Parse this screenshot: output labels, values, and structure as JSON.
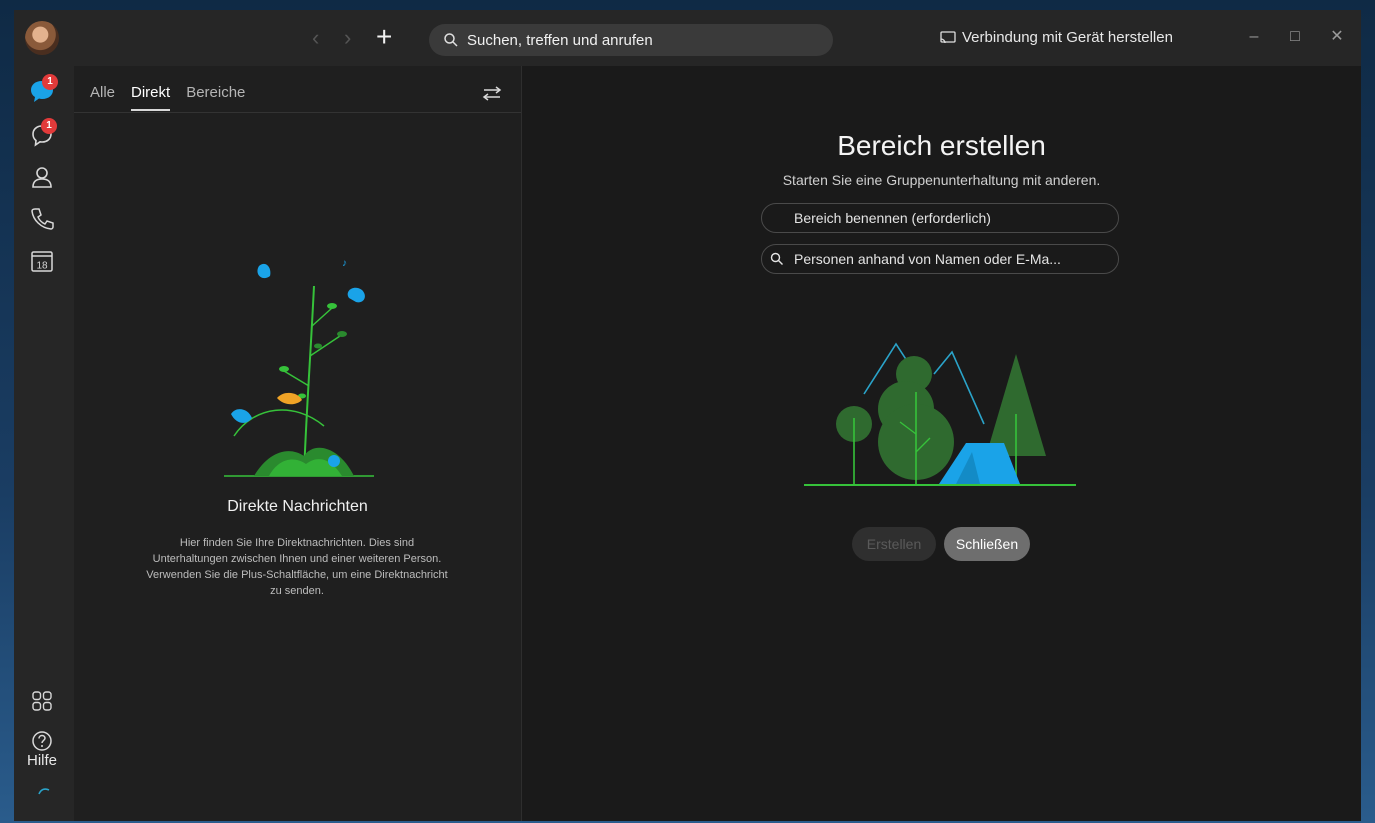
{
  "titlebar": {
    "search_placeholder": "Suchen, treffen und anrufen",
    "connect_label": "Verbindung mit Gerät herstellen",
    "plus_label": "+"
  },
  "leftnav": {
    "messages_badge": "1",
    "teams_badge": "1",
    "calendar_day": "18",
    "help_label": "Hilfe"
  },
  "listpanel": {
    "tabs": [
      "Alle",
      "Direkt",
      "Bereiche"
    ],
    "active_tab": "Direkt",
    "empty_title": "Direkte Nachrichten",
    "empty_description": "Hier finden Sie Ihre Direktnachrichten. Dies sind Unterhaltungen zwischen Ihnen und einer weiteren Person. Verwenden Sie die Plus-Schaltfläche, um eine Direktnachricht zu senden."
  },
  "main": {
    "title": "Bereich erstellen",
    "subtitle": "Starten Sie eine Gruppenunterhaltung mit anderen.",
    "name_placeholder": "Bereich benennen (erforderlich)",
    "people_placeholder": "Personen anhand von Namen oder E-Ma...",
    "create_label": "Erstellen",
    "close_label": "Schließen"
  },
  "colors": {
    "accent_blue": "#1aa3e8",
    "badge_red": "#e23a3a",
    "tree_green": "#2f6a2f",
    "line_green": "#36c23a"
  }
}
